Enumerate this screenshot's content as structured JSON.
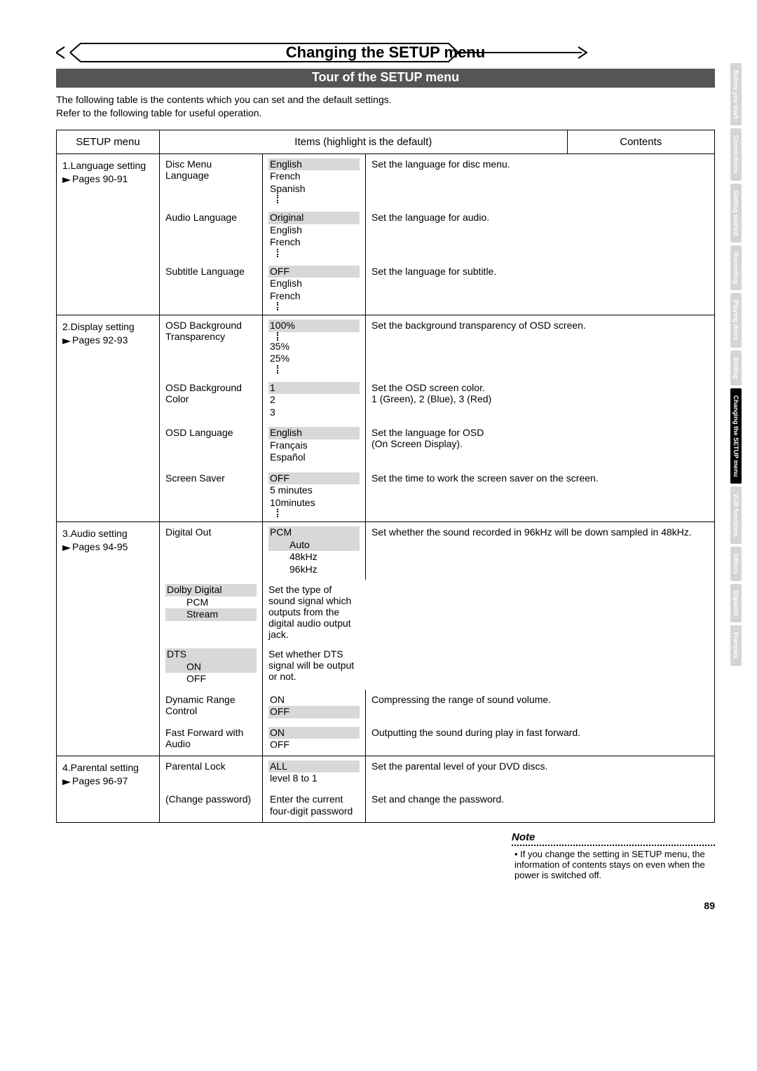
{
  "banner_title": "Changing the SETUP menu",
  "sub_banner": "Tour of the SETUP menu",
  "intro_line1": "The following table is the contents which you can set and the default settings.",
  "intro_line2": "Refer to the following table for useful operation.",
  "headers": {
    "menu": "SETUP menu",
    "items": "Items (highlight is the default)",
    "contents": "Contents"
  },
  "cats": [
    {
      "name": "1.Language setting",
      "pages": "Pages 90-91"
    },
    {
      "name": "2.Display setting",
      "pages": "Pages 92-93"
    },
    {
      "name": "3.Audio setting",
      "pages": "Pages 94-95"
    },
    {
      "name": "4.Parental setting",
      "pages": "Pages 96-97"
    }
  ],
  "rows": {
    "lang": [
      {
        "item": "Disc Menu Language",
        "values": [
          "English",
          "French",
          "Spanish"
        ],
        "default": 0,
        "ellipsis": true,
        "contents": "Set the language for disc menu."
      },
      {
        "item": "Audio Language",
        "values": [
          "Original",
          "English",
          "French"
        ],
        "default": 0,
        "ellipsis": true,
        "contents": "Set the language for audio."
      },
      {
        "item": "Subtitle Language",
        "values": [
          "OFF",
          "English",
          "French"
        ],
        "default": 0,
        "ellipsis": true,
        "contents": "Set the language for subtitle."
      }
    ],
    "disp": [
      {
        "item": "OSD Background Transparency",
        "values": [
          "100%",
          "35%",
          "25%"
        ],
        "default": 0,
        "ellipsis_mid": 1,
        "ellipsis": true,
        "contents": "Set the background transparency of OSD screen."
      },
      {
        "item": "OSD Background Color",
        "values": [
          "1",
          "2",
          "3"
        ],
        "default": 0,
        "contents1": "Set the OSD screen color.",
        "contents2": "1 (Green), 2 (Blue), 3 (Red)"
      },
      {
        "item": "OSD Language",
        "values": [
          "English",
          "Français",
          "Español"
        ],
        "default": 0,
        "contents1": "Set the language for OSD",
        "contents2": "(On Screen Display)."
      },
      {
        "item": "Screen Saver",
        "values": [
          "OFF",
          "5 minutes",
          "10minutes"
        ],
        "default": 0,
        "ellipsis": true,
        "contents": "Set the time to work the screen saver on the screen."
      }
    ],
    "audio": [
      {
        "item": "Digital Out",
        "groups": [
          {
            "heading": "PCM",
            "values": [
              "Auto",
              "48kHz",
              "96kHz"
            ],
            "default": 0,
            "contents": "Set whether the sound recorded in 96kHz will be down sampled in 48kHz."
          },
          {
            "heading": "Dolby Digital",
            "values": [
              "PCM",
              "Stream"
            ],
            "default": 1,
            "contents": "Set the type of sound signal which outputs from the digital audio output jack."
          },
          {
            "heading": "DTS",
            "values": [
              "ON",
              "OFF"
            ],
            "default": 0,
            "contents": "Set whether DTS signal will be output or not."
          }
        ]
      },
      {
        "item": "Dynamic Range Control",
        "values": [
          "ON",
          "OFF"
        ],
        "default": 1,
        "contents": "Compressing the range of sound volume."
      },
      {
        "item": "Fast Forward with Audio",
        "values": [
          "ON",
          "OFF"
        ],
        "default": 0,
        "contents": "Outputting the sound during play in fast forward."
      }
    ],
    "parental": [
      {
        "item": "Parental Lock",
        "values": [
          "ALL",
          "level 8 to 1"
        ],
        "default": 0,
        "contents": "Set the parental level of your DVD discs."
      },
      {
        "item": "(Change password)",
        "values_text": "Enter the current four-digit password",
        "contents": "Set and change the password."
      }
    ]
  },
  "note": {
    "title": "Note",
    "body": "If you change the setting in SETUP menu, the information of contents stays on even when the power is switched off."
  },
  "page_number": "89",
  "tabs": [
    "Before you start",
    "Connections",
    "Getting started",
    "Recording",
    "Playing discs",
    "Editing",
    "Changing the SETUP menu",
    "VCR functions",
    "Others",
    "Español",
    "Français"
  ],
  "active_tab": 6
}
